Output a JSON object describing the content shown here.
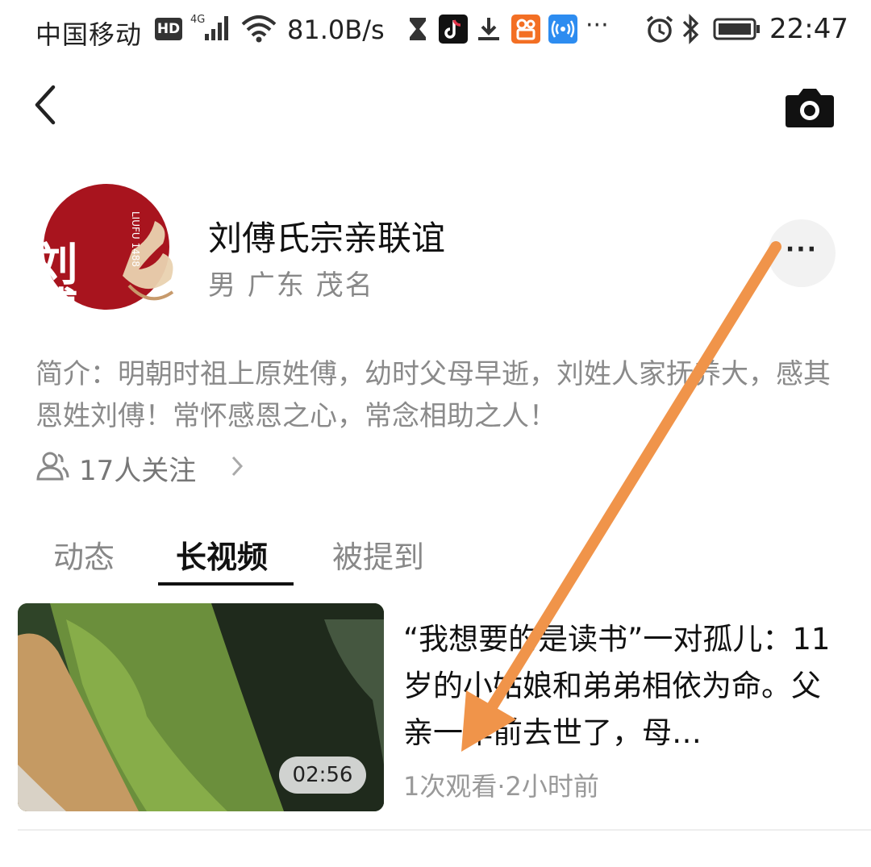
{
  "status_bar": {
    "carrier": "中国移动",
    "hd_badge": "HD",
    "network_type": "4G",
    "speed": "81.0B/s",
    "more": "···",
    "time": "22:47",
    "icons": [
      "hourglass-icon",
      "tiktok-icon",
      "download-icon",
      "kuaishou-icon",
      "hotspot-icon",
      "alarm-icon",
      "bluetooth-icon",
      "battery-icon"
    ]
  },
  "profile": {
    "avatar_text": "刘傅",
    "avatar_sub": "LIUFU 1488",
    "name": "刘傅氏宗亲联谊",
    "gender_location": "男 广东 茂名",
    "bio": "简介：明朝时祖上原姓傅，幼时父母早逝，刘姓人家抚养大，感其恩姓刘傅！常怀感恩之心，常念相助之人！",
    "followers": "17人关注",
    "more_label": "···"
  },
  "tabs": [
    {
      "label": "动态",
      "active": false
    },
    {
      "label": "长视频",
      "active": true
    },
    {
      "label": "被提到",
      "active": false
    }
  ],
  "videos": [
    {
      "title": "“我想要的是读书”一对孤儿：11岁的小姑娘和弟弟相依为命。父亲一年前去世了，母…",
      "duration": "02:56",
      "meta": "1次观看·2小时前"
    }
  ],
  "colors": {
    "avatar_red": "#a8141e",
    "arrow_orange": "#f0944a",
    "muted_text": "#888888"
  }
}
